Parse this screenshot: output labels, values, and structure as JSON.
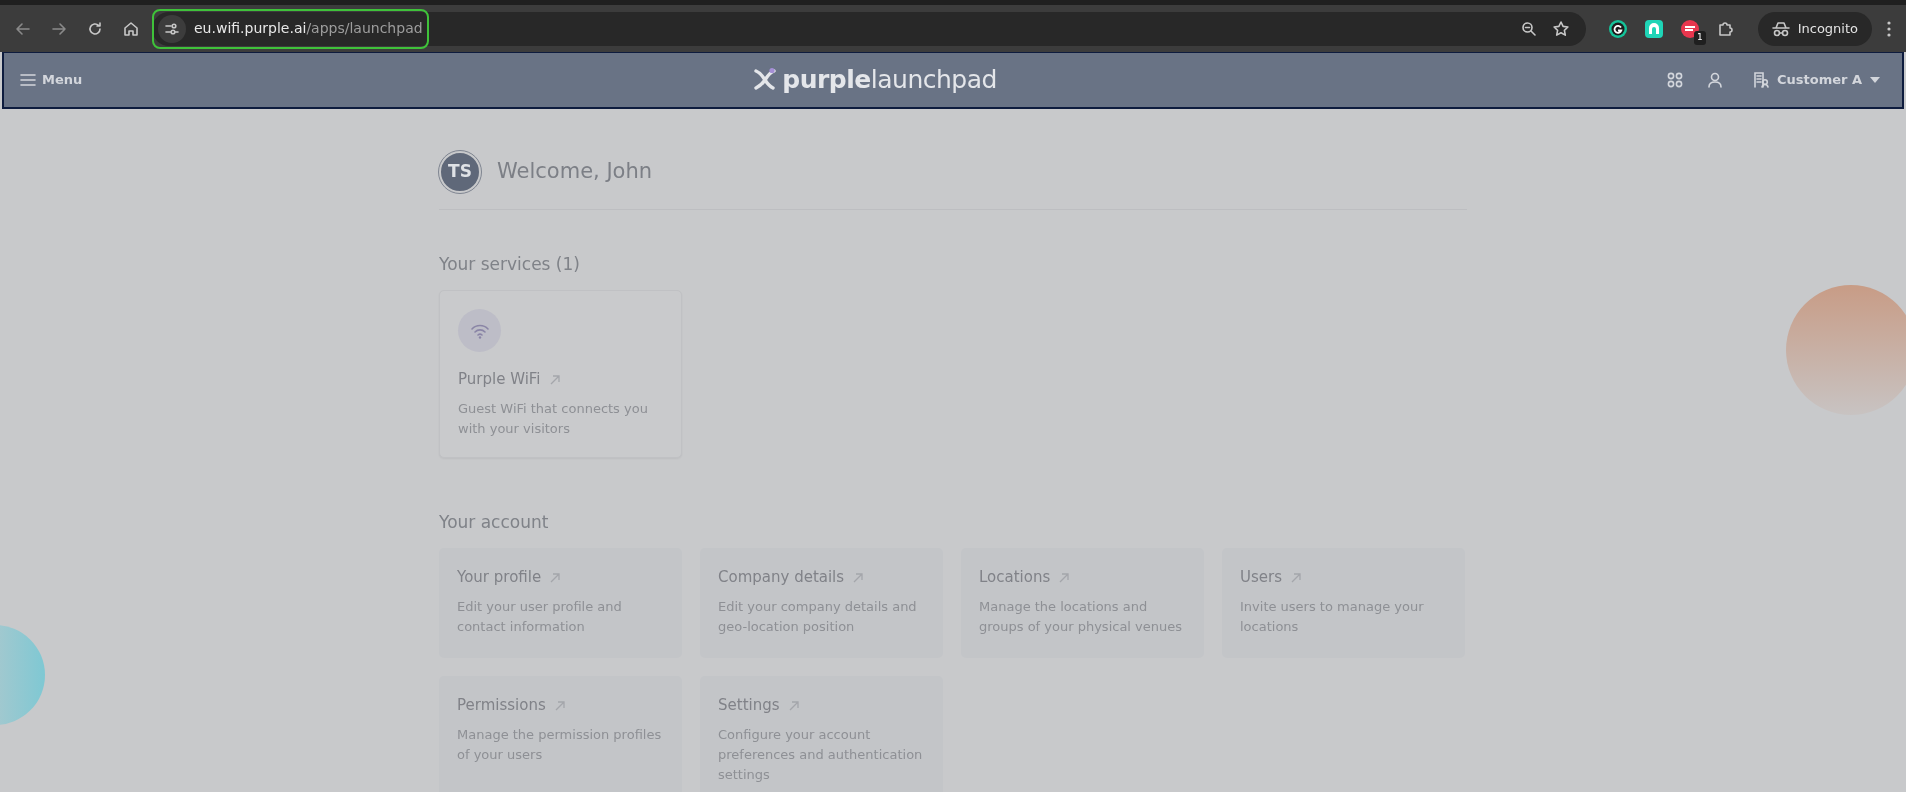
{
  "browser": {
    "url_host": "eu.wifi.purple.ai",
    "url_path": "/apps/launchpad",
    "url_highlighted": true,
    "extension_badge": "1",
    "profile_label": "Incognito"
  },
  "header": {
    "menu_label": "Menu",
    "logo_brand": "purple",
    "logo_product": "launchpad",
    "account_label": "Customer A"
  },
  "welcome": {
    "initials": "TS",
    "greeting": "Welcome, John"
  },
  "services": {
    "heading": "Your services (1)",
    "items": [
      {
        "title": "Purple WiFi",
        "description": "Guest WiFi that connects you with your visitors"
      }
    ]
  },
  "account": {
    "heading": "Your account",
    "items": [
      {
        "title": "Your profile",
        "description": "Edit your user profile and contact information"
      },
      {
        "title": "Company details",
        "description": "Edit your company details and geo-location position"
      },
      {
        "title": "Locations",
        "description": "Manage the locations and groups of your physical venues"
      },
      {
        "title": "Users",
        "description": "Invite users to manage your locations"
      },
      {
        "title": "Permissions",
        "description": "Manage the permission profiles of your users"
      },
      {
        "title": "Settings",
        "description": "Configure your account preferences and authentication settings"
      }
    ]
  }
}
